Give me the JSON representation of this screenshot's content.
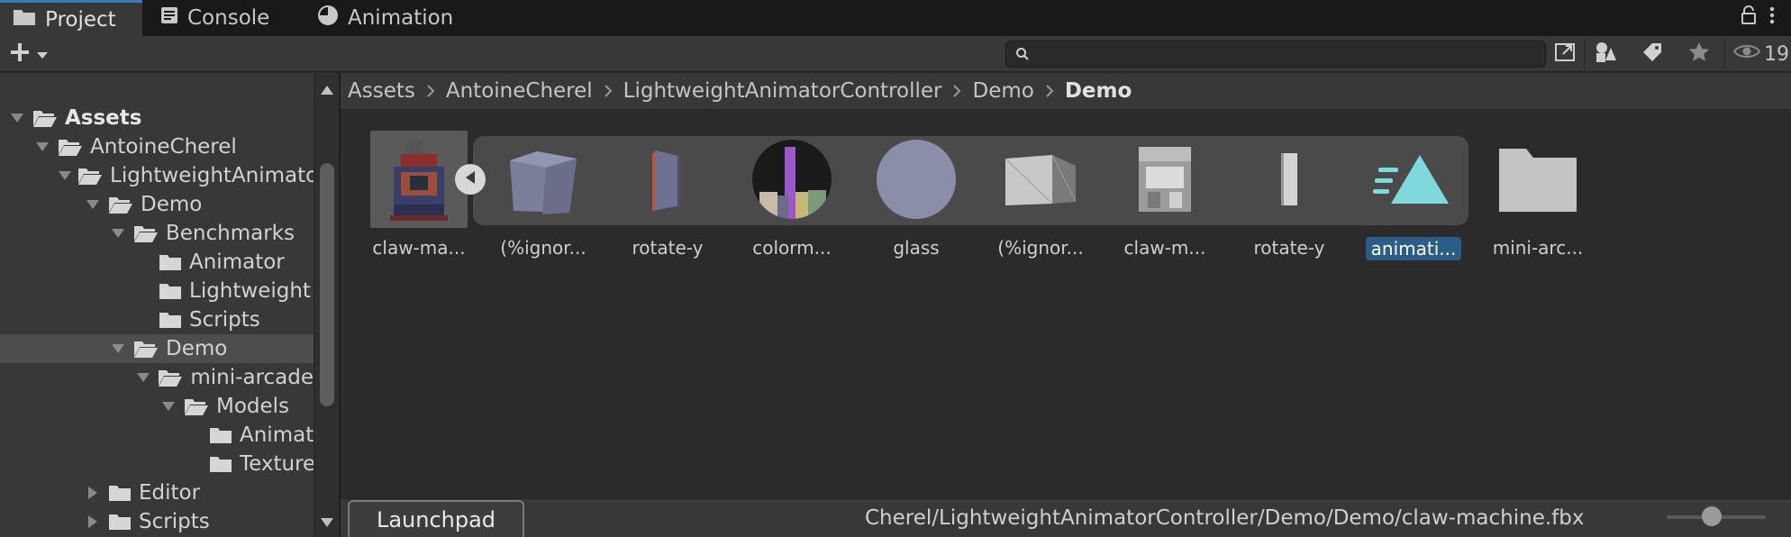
{
  "tabs": [
    {
      "label": "Project",
      "icon": "folder-icon",
      "active": true
    },
    {
      "label": "Console",
      "icon": "console-icon",
      "active": false
    },
    {
      "label": "Animation",
      "icon": "clock-icon",
      "active": false
    }
  ],
  "toolbar": {
    "search_placeholder": "",
    "visibility_count": "19"
  },
  "tree": [
    {
      "label": "Assets",
      "expanded": true,
      "bold": true
    },
    {
      "label": "AntoineCherel",
      "expanded": true
    },
    {
      "label": "LightweightAnimato",
      "expanded": true
    },
    {
      "label": "Demo",
      "expanded": true
    },
    {
      "label": "Benchmarks",
      "expanded": true
    },
    {
      "label": "Animator"
    },
    {
      "label": "Lightweight"
    },
    {
      "label": "Scripts"
    },
    {
      "label": "Demo",
      "expanded": true,
      "selected": true
    },
    {
      "label": "mini-arcade",
      "expanded": true
    },
    {
      "label": "Models",
      "expanded": true
    },
    {
      "label": "Animati"
    },
    {
      "label": "Texture"
    },
    {
      "label": "Editor",
      "expanded": false
    },
    {
      "label": "Scripts",
      "expanded": false
    }
  ],
  "breadcrumb": [
    "Assets",
    "AntoineCherel",
    "LightweightAnimatorController",
    "Demo",
    "Demo"
  ],
  "assets": [
    {
      "label": "claw-ma...",
      "icon": "claw-machine-model-icon"
    },
    {
      "label": "(%ignor...",
      "icon": "cube-mesh-icon"
    },
    {
      "label": "rotate-y",
      "icon": "box-mesh-icon"
    },
    {
      "label": "colorm...",
      "icon": "colormap-material-icon"
    },
    {
      "label": "glass",
      "icon": "glass-material-icon"
    },
    {
      "label": "(%ignor...",
      "icon": "plane-mesh-icon"
    },
    {
      "label": "claw-m...",
      "icon": "claw-machine-mesh-icon"
    },
    {
      "label": "rotate-y",
      "icon": "thin-box-mesh-icon"
    },
    {
      "label": "animati...",
      "icon": "animation-clip-icon",
      "selected": true
    },
    {
      "label": "mini-arc...",
      "icon": "folder-icon"
    }
  ],
  "status": {
    "launchpad_label": "Launchpad",
    "path": "Cherel/LightweightAnimatorController/Demo/Demo/claw-machine.fbx"
  },
  "zoom_slider_value": 0.45,
  "colors": {
    "accent": "#3a79bb",
    "selection": "#2c5d87",
    "animation_icon": "#7fd8dc"
  }
}
